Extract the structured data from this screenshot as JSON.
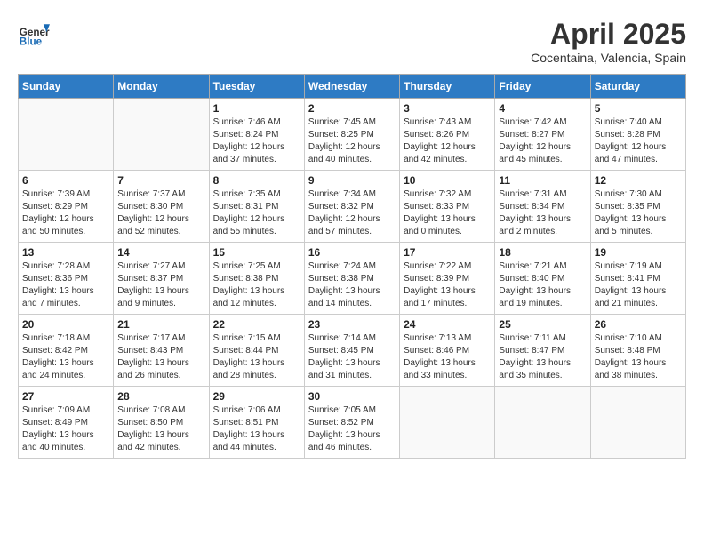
{
  "header": {
    "logo_general": "General",
    "logo_blue": "Blue",
    "month_title": "April 2025",
    "location": "Cocentaina, Valencia, Spain"
  },
  "days_of_week": [
    "Sunday",
    "Monday",
    "Tuesday",
    "Wednesday",
    "Thursday",
    "Friday",
    "Saturday"
  ],
  "weeks": [
    [
      {
        "day": "",
        "info": ""
      },
      {
        "day": "",
        "info": ""
      },
      {
        "day": "1",
        "info": "Sunrise: 7:46 AM\nSunset: 8:24 PM\nDaylight: 12 hours and 37 minutes."
      },
      {
        "day": "2",
        "info": "Sunrise: 7:45 AM\nSunset: 8:25 PM\nDaylight: 12 hours and 40 minutes."
      },
      {
        "day": "3",
        "info": "Sunrise: 7:43 AM\nSunset: 8:26 PM\nDaylight: 12 hours and 42 minutes."
      },
      {
        "day": "4",
        "info": "Sunrise: 7:42 AM\nSunset: 8:27 PM\nDaylight: 12 hours and 45 minutes."
      },
      {
        "day": "5",
        "info": "Sunrise: 7:40 AM\nSunset: 8:28 PM\nDaylight: 12 hours and 47 minutes."
      }
    ],
    [
      {
        "day": "6",
        "info": "Sunrise: 7:39 AM\nSunset: 8:29 PM\nDaylight: 12 hours and 50 minutes."
      },
      {
        "day": "7",
        "info": "Sunrise: 7:37 AM\nSunset: 8:30 PM\nDaylight: 12 hours and 52 minutes."
      },
      {
        "day": "8",
        "info": "Sunrise: 7:35 AM\nSunset: 8:31 PM\nDaylight: 12 hours and 55 minutes."
      },
      {
        "day": "9",
        "info": "Sunrise: 7:34 AM\nSunset: 8:32 PM\nDaylight: 12 hours and 57 minutes."
      },
      {
        "day": "10",
        "info": "Sunrise: 7:32 AM\nSunset: 8:33 PM\nDaylight: 13 hours and 0 minutes."
      },
      {
        "day": "11",
        "info": "Sunrise: 7:31 AM\nSunset: 8:34 PM\nDaylight: 13 hours and 2 minutes."
      },
      {
        "day": "12",
        "info": "Sunrise: 7:30 AM\nSunset: 8:35 PM\nDaylight: 13 hours and 5 minutes."
      }
    ],
    [
      {
        "day": "13",
        "info": "Sunrise: 7:28 AM\nSunset: 8:36 PM\nDaylight: 13 hours and 7 minutes."
      },
      {
        "day": "14",
        "info": "Sunrise: 7:27 AM\nSunset: 8:37 PM\nDaylight: 13 hours and 9 minutes."
      },
      {
        "day": "15",
        "info": "Sunrise: 7:25 AM\nSunset: 8:38 PM\nDaylight: 13 hours and 12 minutes."
      },
      {
        "day": "16",
        "info": "Sunrise: 7:24 AM\nSunset: 8:38 PM\nDaylight: 13 hours and 14 minutes."
      },
      {
        "day": "17",
        "info": "Sunrise: 7:22 AM\nSunset: 8:39 PM\nDaylight: 13 hours and 17 minutes."
      },
      {
        "day": "18",
        "info": "Sunrise: 7:21 AM\nSunset: 8:40 PM\nDaylight: 13 hours and 19 minutes."
      },
      {
        "day": "19",
        "info": "Sunrise: 7:19 AM\nSunset: 8:41 PM\nDaylight: 13 hours and 21 minutes."
      }
    ],
    [
      {
        "day": "20",
        "info": "Sunrise: 7:18 AM\nSunset: 8:42 PM\nDaylight: 13 hours and 24 minutes."
      },
      {
        "day": "21",
        "info": "Sunrise: 7:17 AM\nSunset: 8:43 PM\nDaylight: 13 hours and 26 minutes."
      },
      {
        "day": "22",
        "info": "Sunrise: 7:15 AM\nSunset: 8:44 PM\nDaylight: 13 hours and 28 minutes."
      },
      {
        "day": "23",
        "info": "Sunrise: 7:14 AM\nSunset: 8:45 PM\nDaylight: 13 hours and 31 minutes."
      },
      {
        "day": "24",
        "info": "Sunrise: 7:13 AM\nSunset: 8:46 PM\nDaylight: 13 hours and 33 minutes."
      },
      {
        "day": "25",
        "info": "Sunrise: 7:11 AM\nSunset: 8:47 PM\nDaylight: 13 hours and 35 minutes."
      },
      {
        "day": "26",
        "info": "Sunrise: 7:10 AM\nSunset: 8:48 PM\nDaylight: 13 hours and 38 minutes."
      }
    ],
    [
      {
        "day": "27",
        "info": "Sunrise: 7:09 AM\nSunset: 8:49 PM\nDaylight: 13 hours and 40 minutes."
      },
      {
        "day": "28",
        "info": "Sunrise: 7:08 AM\nSunset: 8:50 PM\nDaylight: 13 hours and 42 minutes."
      },
      {
        "day": "29",
        "info": "Sunrise: 7:06 AM\nSunset: 8:51 PM\nDaylight: 13 hours and 44 minutes."
      },
      {
        "day": "30",
        "info": "Sunrise: 7:05 AM\nSunset: 8:52 PM\nDaylight: 13 hours and 46 minutes."
      },
      {
        "day": "",
        "info": ""
      },
      {
        "day": "",
        "info": ""
      },
      {
        "day": "",
        "info": ""
      }
    ]
  ]
}
